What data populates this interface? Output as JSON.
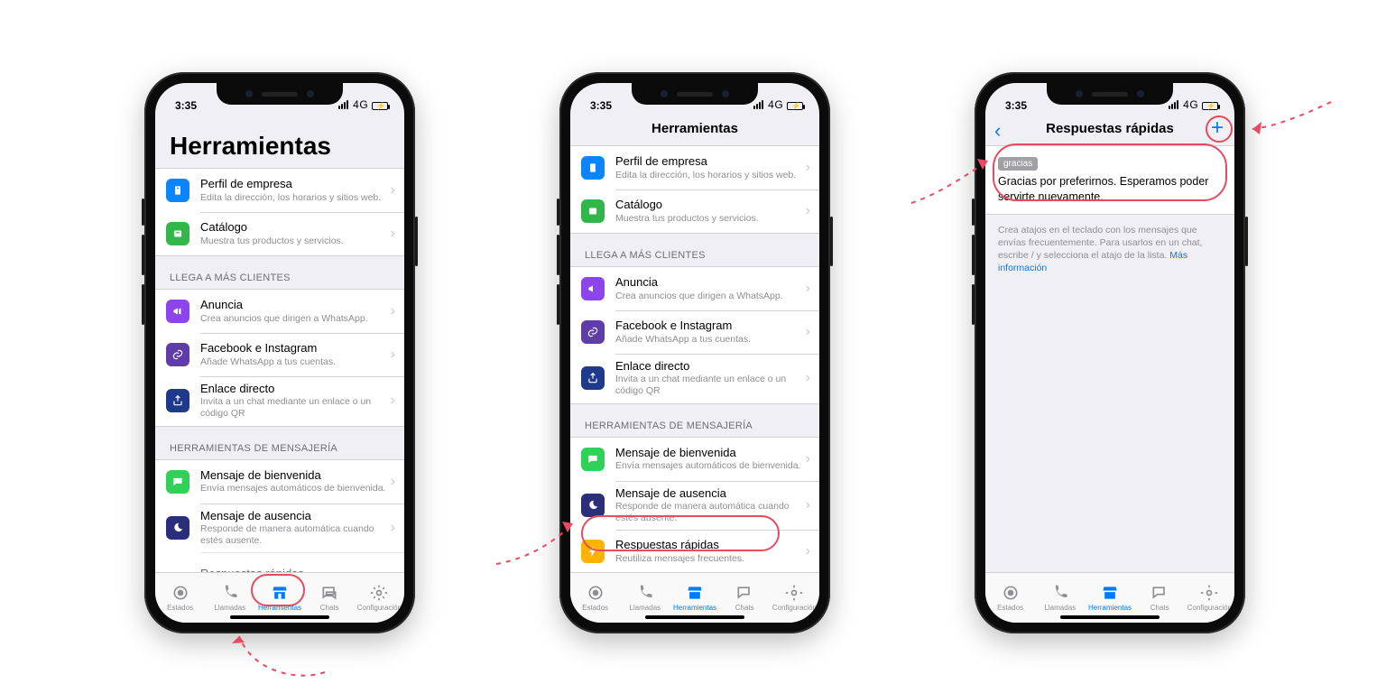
{
  "status": {
    "time": "3:35",
    "net": "4G"
  },
  "tabs": {
    "estados": "Estados",
    "llamadas": "Llamadas",
    "herramientas": "Herramientas",
    "chats": "Chats",
    "config": "Configuración"
  },
  "screen1": {
    "title": "Herramientas",
    "group1": [
      {
        "title": "Perfil de empresa",
        "sub": "Edita la dirección, los horarios y sitios web."
      },
      {
        "title": "Catálogo",
        "sub": "Muestra tus productos y servicios."
      }
    ],
    "h2": "LLEGA A MÁS CLIENTES",
    "group2": [
      {
        "title": "Anuncia",
        "sub": "Crea anuncios que dirigen a WhatsApp."
      },
      {
        "title": "Facebook e Instagram",
        "sub": "Añade WhatsApp a tus cuentas."
      },
      {
        "title": "Enlace directo",
        "sub": "Invita a un chat mediante un enlace o un código QR"
      }
    ],
    "h3": "HERRAMIENTAS DE MENSAJERÍA",
    "group3": [
      {
        "title": "Mensaje de bienvenida",
        "sub": "Envía mensajes automáticos de bienvenida."
      },
      {
        "title": "Mensaje de ausencia",
        "sub": "Responde de manera automática cuando estés ausente."
      },
      {
        "title": "Respuestas rápidas",
        "sub": ""
      }
    ]
  },
  "screen2": {
    "title": "Herramientas",
    "group1": [
      {
        "title": "Perfil de empresa",
        "sub": "Edita la dirección, los horarios y sitios web."
      },
      {
        "title": "Catálogo",
        "sub": "Muestra tus productos y servicios."
      }
    ],
    "h2": "LLEGA A MÁS CLIENTES",
    "group2": [
      {
        "title": "Anuncia",
        "sub": "Crea anuncios que dirigen a WhatsApp."
      },
      {
        "title": "Facebook e Instagram",
        "sub": "Añade WhatsApp a tus cuentas."
      },
      {
        "title": "Enlace directo",
        "sub": "Invita a un chat mediante un enlace o un código QR"
      }
    ],
    "h3": "HERRAMIENTAS DE MENSAJERÍA",
    "group3": [
      {
        "title": "Mensaje de bienvenida",
        "sub": "Envía mensajes automáticos de bienvenida."
      },
      {
        "title": "Mensaje de ausencia",
        "sub": "Responde de manera automática cuando estés ausente."
      },
      {
        "title": "Respuestas rápidas",
        "sub": "Reutiliza mensajes frecuentes."
      }
    ]
  },
  "screen3": {
    "title": "Respuestas rápidas",
    "chip": "gracias",
    "reply": "Gracias por preferirnos. Esperamos poder servirte nuevamente.",
    "footer": "Crea atajos en el teclado con los mensajes que envías frecuentemente. Para usarlos en un chat, escribe / y selecciona el atajo de la lista. ",
    "more": "Más información"
  }
}
